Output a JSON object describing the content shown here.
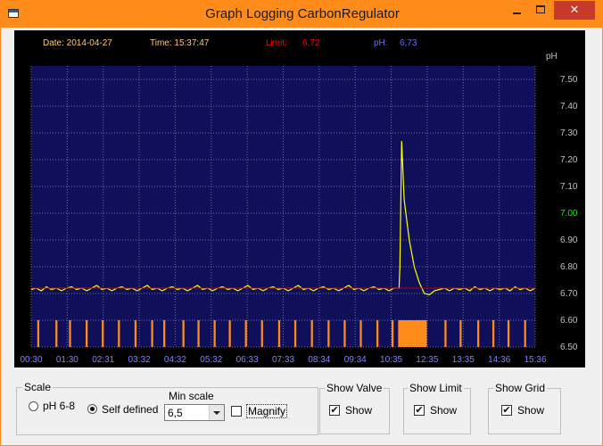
{
  "window": {
    "title": "Graph Logging CarbonRegulator",
    "close_glyph": "✕"
  },
  "header": {
    "date_label": "Date: 2014-04-27",
    "time_label": "Time: 15:37:47",
    "limit_label": "Limit:",
    "limit_value": "6,72",
    "ph_label": "pH:",
    "ph_value": "6,73"
  },
  "colors": {
    "plot_bg": "#10105a",
    "grid": "#7070a0",
    "ph_line": "#ffff00",
    "limit_line": "#b00000",
    "valve": "#ff8c1a",
    "x_tick": "#8080ff",
    "y_tick": "#c0c0c0",
    "y_tick_center": "#00ff00",
    "date_time": "#ffcc66",
    "limit_text": "#ff0000",
    "ph_text": "#6a6aff"
  },
  "chart_data": {
    "type": "line",
    "ylabel": "pH",
    "ylim": [
      6.5,
      7.55
    ],
    "y_ticks": [
      "7.50",
      "7.40",
      "7.30",
      "7.20",
      "7.10",
      "7.00",
      "6.90",
      "6.80",
      "6.70",
      "6.60",
      "6.50"
    ],
    "x_ticks": [
      "00:30",
      "01:30",
      "02:31",
      "03:32",
      "04:32",
      "05:32",
      "06:33",
      "07:33",
      "08:34",
      "09:34",
      "10:35",
      "12:35",
      "13:35",
      "14:36",
      "15:36"
    ],
    "grid": true,
    "series": [
      {
        "key": "ph",
        "x": [
          0.0,
          0.01,
          0.02,
          0.03,
          0.04,
          0.05,
          0.06,
          0.07,
          0.08,
          0.09,
          0.1,
          0.11,
          0.12,
          0.13,
          0.14,
          0.15,
          0.16,
          0.17,
          0.18,
          0.19,
          0.2,
          0.21,
          0.22,
          0.23,
          0.24,
          0.25,
          0.26,
          0.27,
          0.28,
          0.29,
          0.3,
          0.31,
          0.32,
          0.33,
          0.34,
          0.35,
          0.36,
          0.37,
          0.38,
          0.39,
          0.4,
          0.41,
          0.42,
          0.43,
          0.44,
          0.45,
          0.46,
          0.47,
          0.48,
          0.49,
          0.5,
          0.51,
          0.52,
          0.53,
          0.54,
          0.55,
          0.56,
          0.57,
          0.58,
          0.59,
          0.6,
          0.61,
          0.62,
          0.63,
          0.64,
          0.65,
          0.66,
          0.67,
          0.68,
          0.69,
          0.7,
          0.71,
          0.72,
          0.73,
          0.7315,
          0.735,
          0.74,
          0.75,
          0.76,
          0.77,
          0.78,
          0.79,
          0.8,
          0.81,
          0.82,
          0.83,
          0.84,
          0.85,
          0.86,
          0.87,
          0.88,
          0.89,
          0.9,
          0.91,
          0.92,
          0.93,
          0.94,
          0.95,
          0.96,
          0.97,
          0.98,
          0.99,
          1.0
        ],
        "y": [
          6.715,
          6.72,
          6.71,
          6.725,
          6.715,
          6.72,
          6.71,
          6.72,
          6.725,
          6.715,
          6.72,
          6.71,
          6.72,
          6.73,
          6.715,
          6.72,
          6.71,
          6.72,
          6.725,
          6.715,
          6.72,
          6.71,
          6.72,
          6.73,
          6.715,
          6.72,
          6.71,
          6.72,
          6.725,
          6.715,
          6.72,
          6.71,
          6.72,
          6.73,
          6.715,
          6.72,
          6.71,
          6.72,
          6.725,
          6.715,
          6.72,
          6.71,
          6.72,
          6.73,
          6.715,
          6.72,
          6.71,
          6.72,
          6.725,
          6.715,
          6.72,
          6.71,
          6.72,
          6.73,
          6.715,
          6.72,
          6.71,
          6.72,
          6.725,
          6.715,
          6.72,
          6.71,
          6.72,
          6.73,
          6.715,
          6.72,
          6.71,
          6.72,
          6.725,
          6.715,
          6.72,
          6.71,
          6.72,
          6.72,
          6.8,
          7.27,
          7.05,
          6.9,
          6.8,
          6.74,
          6.7,
          6.695,
          6.71,
          6.715,
          6.72,
          6.71,
          6.72,
          6.715,
          6.72,
          6.71,
          6.725,
          6.715,
          6.72,
          6.71,
          6.72,
          6.715,
          6.72,
          6.71,
          6.725,
          6.715,
          6.72,
          6.71,
          6.72
        ]
      },
      {
        "key": "limit",
        "x": [
          0.0,
          1.0
        ],
        "y": [
          6.72,
          6.72
        ]
      }
    ],
    "valve_spans": [
      [
        0.012,
        0.016
      ],
      [
        0.048,
        0.052
      ],
      [
        0.075,
        0.079
      ],
      [
        0.108,
        0.112
      ],
      [
        0.14,
        0.144
      ],
      [
        0.172,
        0.176
      ],
      [
        0.205,
        0.209
      ],
      [
        0.238,
        0.242
      ],
      [
        0.262,
        0.266
      ],
      [
        0.3,
        0.304
      ],
      [
        0.33,
        0.334
      ],
      [
        0.362,
        0.366
      ],
      [
        0.392,
        0.396
      ],
      [
        0.424,
        0.428
      ],
      [
        0.456,
        0.46
      ],
      [
        0.49,
        0.494
      ],
      [
        0.522,
        0.526
      ],
      [
        0.555,
        0.559
      ],
      [
        0.588,
        0.592
      ],
      [
        0.62,
        0.624
      ],
      [
        0.652,
        0.656
      ],
      [
        0.685,
        0.689
      ],
      [
        0.715,
        0.719
      ],
      [
        0.728,
        0.785
      ],
      [
        0.82,
        0.824
      ],
      [
        0.85,
        0.854
      ],
      [
        0.885,
        0.889
      ],
      [
        0.915,
        0.919
      ],
      [
        0.945,
        0.949
      ],
      [
        0.978,
        0.982
      ]
    ]
  },
  "controls": {
    "scale": {
      "legend": "Scale",
      "option_ph68": "pH 6-8",
      "option_self": "Self defined",
      "min_scale_label": "Min scale",
      "min_scale_value": "6,5",
      "magnify_label": "Magnify"
    },
    "show_valve": {
      "legend": "Show Valve",
      "check_label": "Show"
    },
    "show_limit": {
      "legend": "Show Limit",
      "check_label": "Show"
    },
    "show_grid": {
      "legend": "Show Grid",
      "check_label": "Show"
    },
    "check_glyph": "✔"
  }
}
